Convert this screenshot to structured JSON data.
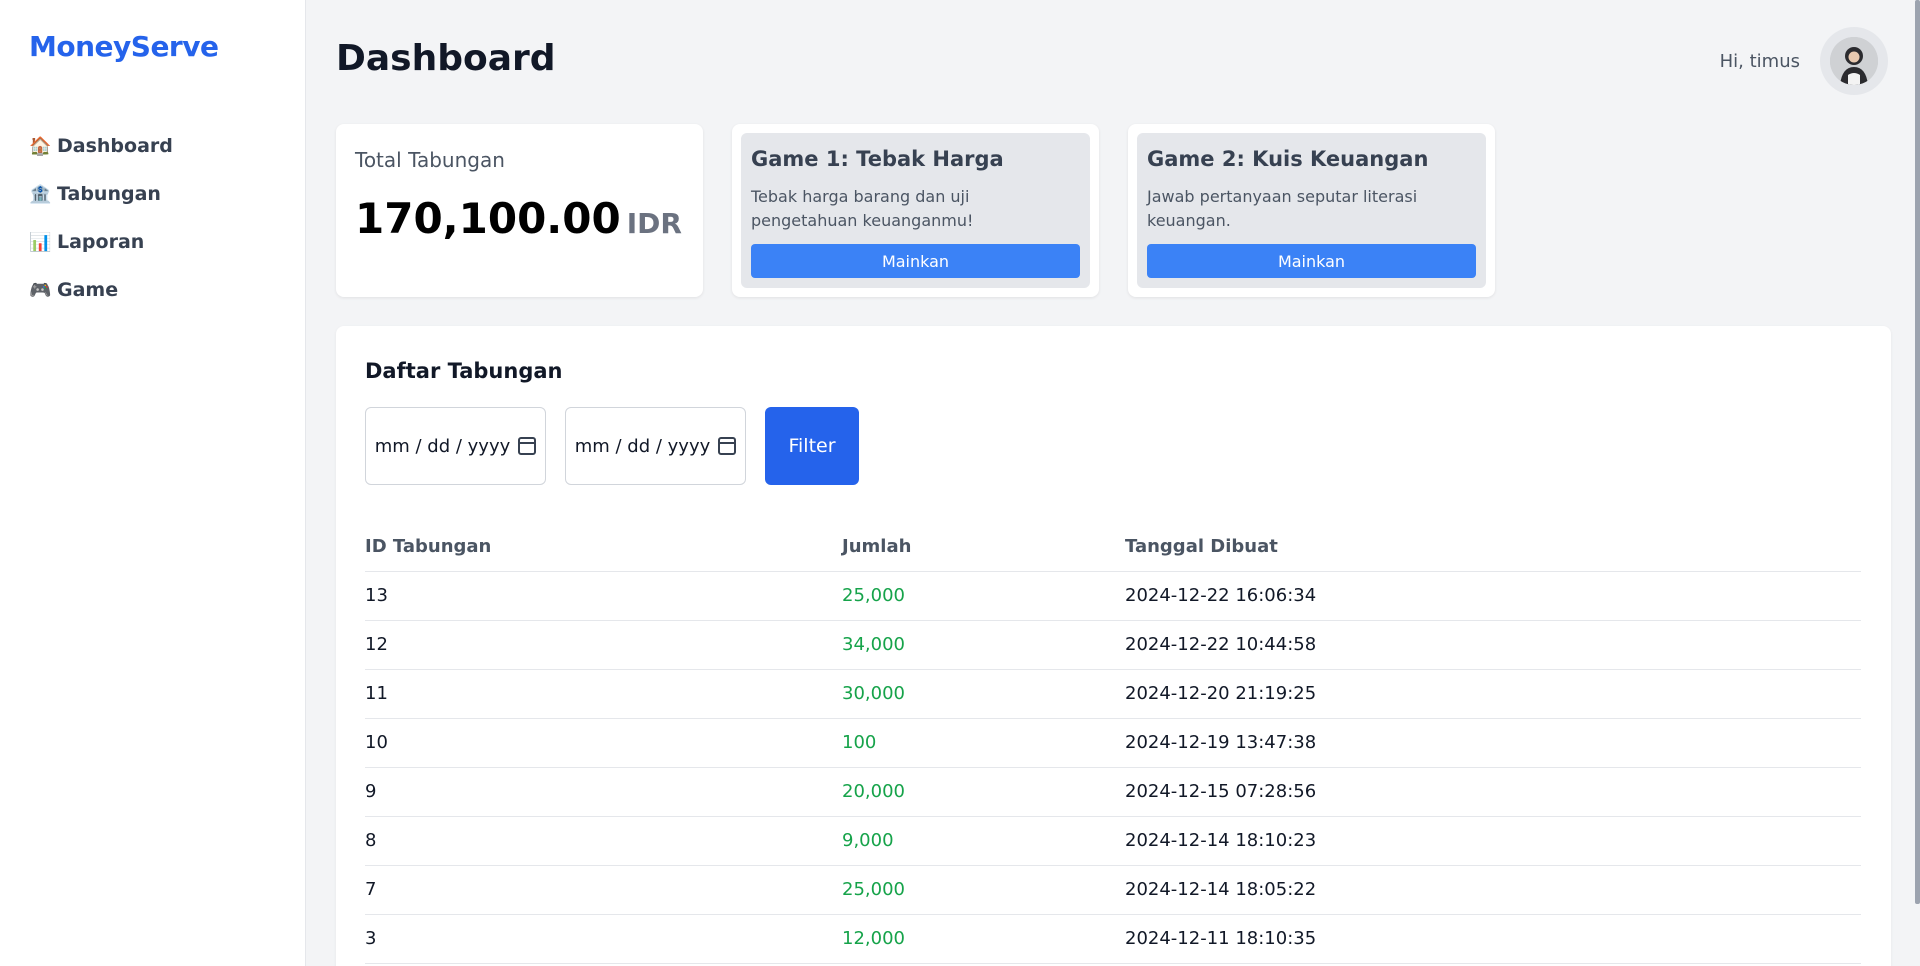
{
  "brand": "MoneyServe",
  "sidebar": {
    "items": [
      {
        "icon": "🏠",
        "label": "Dashboard"
      },
      {
        "icon": "🏦",
        "label": "Tabungan"
      },
      {
        "icon": "📊",
        "label": "Laporan"
      },
      {
        "icon": "🎮",
        "label": "Game"
      }
    ]
  },
  "header": {
    "title": "Dashboard",
    "greeting": "Hi, timus"
  },
  "summary": {
    "label": "Total Tabungan",
    "value": "170,100.00",
    "currency": "IDR"
  },
  "games": [
    {
      "title": "Game 1: Tebak Harga",
      "description": "Tebak harga barang dan uji pengetahuan keuanganmu!",
      "button": "Mainkan"
    },
    {
      "title": "Game 2: Kuis Keuangan",
      "description": "Jawab pertanyaan seputar literasi keuangan.",
      "button": "Mainkan"
    }
  ],
  "savings": {
    "title": "Daftar Tabungan",
    "date_start_placeholder": "mm / dd / yyyy",
    "date_end_placeholder": "mm / dd / yyyy",
    "filter_label": "Filter",
    "columns": [
      "ID Tabungan",
      "Jumlah",
      "Tanggal Dibuat"
    ],
    "rows": [
      {
        "id": "13",
        "amount": "25,000",
        "date": "2024-12-22 16:06:34"
      },
      {
        "id": "12",
        "amount": "34,000",
        "date": "2024-12-22 10:44:58"
      },
      {
        "id": "11",
        "amount": "30,000",
        "date": "2024-12-20 21:19:25"
      },
      {
        "id": "10",
        "amount": "100",
        "date": "2024-12-19 13:47:38"
      },
      {
        "id": "9",
        "amount": "20,000",
        "date": "2024-12-15 07:28:56"
      },
      {
        "id": "8",
        "amount": "9,000",
        "date": "2024-12-14 18:10:23"
      },
      {
        "id": "7",
        "amount": "25,000",
        "date": "2024-12-14 18:05:22"
      },
      {
        "id": "3",
        "amount": "12,000",
        "date": "2024-12-11 18:10:35"
      }
    ]
  },
  "colors": {
    "brand": "#2563eb",
    "button": "#3b82f6",
    "amount": "#16a34a"
  }
}
